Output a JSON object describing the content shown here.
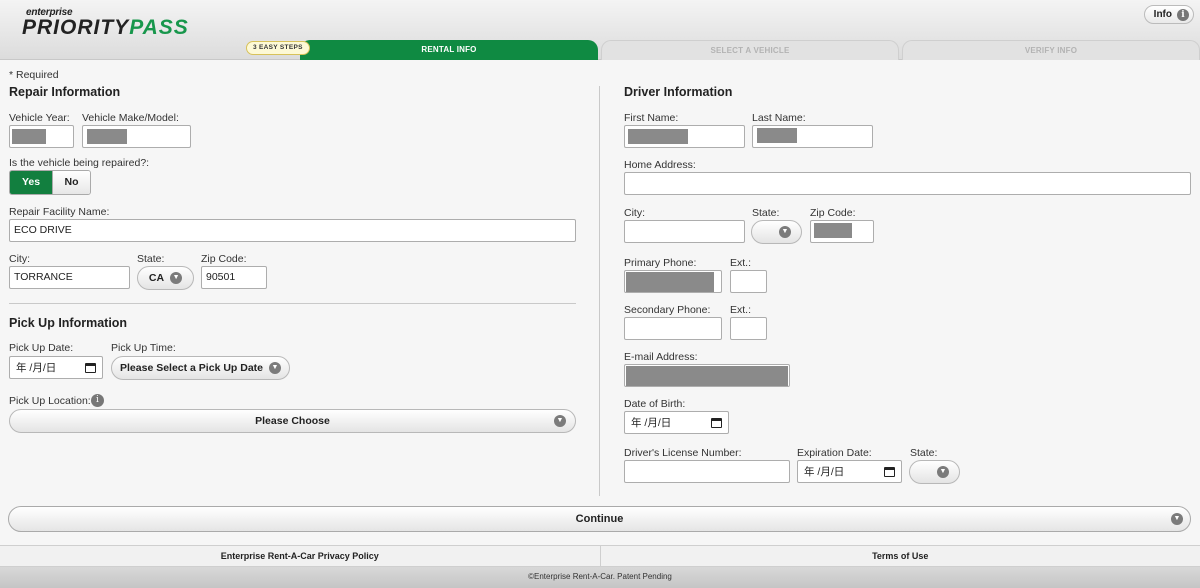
{
  "brand": {
    "small": "enterprise",
    "part1": "PRIORITY",
    "part2": "PASS"
  },
  "header": {
    "info_label": "Info",
    "steps_badge": "3 EASY STEPS"
  },
  "steps": [
    "RENTAL INFO",
    "SELECT A VEHICLE",
    "VERIFY INFO"
  ],
  "required_note": "* Required",
  "repair": {
    "heading": "Repair Information",
    "vehicle_year_label": "Vehicle Year:",
    "vehicle_make_label": "Vehicle Make/Model:",
    "repaired_question": "Is the vehicle being repaired?:",
    "yes_label": "Yes",
    "no_label": "No",
    "facility_label": "Repair Facility Name:",
    "facility_value": "ECO DRIVE",
    "city_label": "City:",
    "city_value": "TORRANCE",
    "state_label": "State:",
    "state_value": "CA",
    "zip_label": "Zip Code:",
    "zip_value": "90501"
  },
  "pickup": {
    "heading": "Pick Up Information",
    "date_label": "Pick Up Date:",
    "date_placeholder": "年 /月/日",
    "time_label": "Pick Up Time:",
    "time_value": "Please Select a Pick Up Date",
    "location_label": "Pick Up Location:",
    "location_value": "Please Choose"
  },
  "driver": {
    "heading": "Driver Information",
    "first_name_label": "First Name:",
    "last_name_label": "Last Name:",
    "address_label": "Home Address:",
    "city_label": "City:",
    "state_label": "State:",
    "zip_label": "Zip Code:",
    "primary_phone_label": "Primary Phone:",
    "ext_label": "Ext.:",
    "secondary_phone_label": "Secondary Phone:",
    "ext2_label": "Ext.:",
    "email_label": "E-mail Address:",
    "dob_label": "Date of Birth:",
    "dob_placeholder": "年 /月/日",
    "license_label": "Driver's License Number:",
    "expiration_label": "Expiration Date:",
    "expiration_placeholder": "年 /月/日",
    "license_state_label": "State:"
  },
  "continue_label": "Continue",
  "footer": {
    "privacy": "Enterprise Rent-A-Car Privacy Policy",
    "terms": "Terms of Use",
    "copyright": "©Enterprise Rent-A-Car. Patent Pending"
  }
}
